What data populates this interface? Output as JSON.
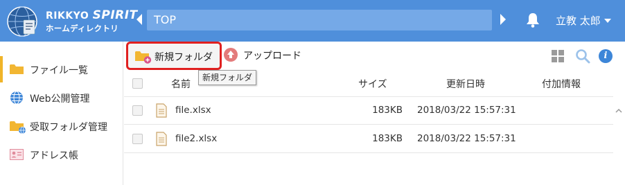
{
  "header": {
    "logo_line1_prefix": "RIKKYO ",
    "logo_line1_brand": "SPIRIT",
    "logo_line2": "ホームディレクトリ",
    "path": "TOP",
    "user_name": "立教 太郎"
  },
  "sidebar": {
    "items": [
      {
        "label": "ファイル一覧",
        "icon": "folder-icon"
      },
      {
        "label": "Web公開管理",
        "icon": "globe-icon"
      },
      {
        "label": "受取フォルダ管理",
        "icon": "shared-folder-icon"
      },
      {
        "label": "アドレス帳",
        "icon": "address-book-icon"
      }
    ]
  },
  "toolbar": {
    "new_folder_label": "新規フォルダ",
    "upload_label": "アップロード"
  },
  "tooltip": "新規フォルダ",
  "table": {
    "columns": [
      "名前",
      "サイズ",
      "更新日時",
      "付加情報"
    ],
    "rows": [
      {
        "name": "file.xlsx",
        "size": "183KB",
        "modified": "2018/03/22 15:57:31",
        "extra": ""
      },
      {
        "name": "file2.xlsx",
        "size": "183KB",
        "modified": "2018/03/22 15:57:31",
        "extra": ""
      }
    ]
  },
  "colors": {
    "header_bg": "#4f8fdb",
    "path_bg": "#75a9e7",
    "active_indicator": "#f0b429",
    "highlight_border": "#e02020",
    "info_icon": "#3d86d8"
  }
}
